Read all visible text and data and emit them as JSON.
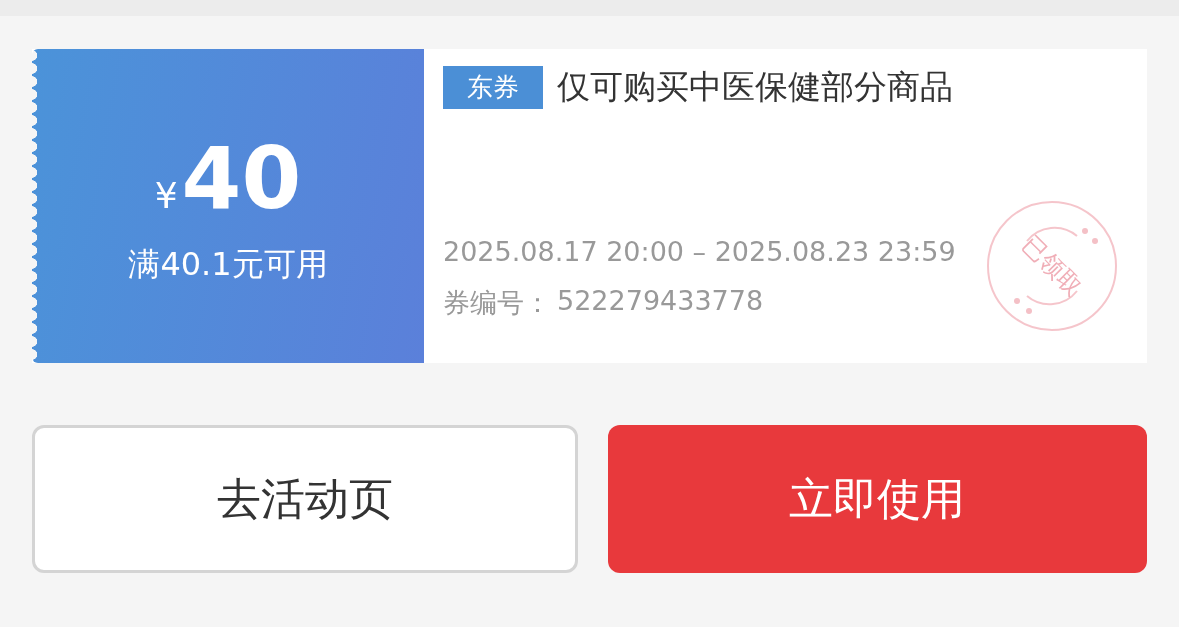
{
  "coupon": {
    "currency": "¥",
    "amount": "40",
    "condition": "满40.1元可用",
    "tag": "东券",
    "title": "仅可购买中医保健部分商品",
    "validity": "2025.08.17 20:00 – 2025.08.23 23:59",
    "code_label": "券编号：",
    "code": "522279433778",
    "stamp": {
      "label": "已领取"
    }
  },
  "buttons": [
    {
      "label": "去活动页",
      "kind": "secondary"
    },
    {
      "label": "立即使用",
      "kind": "primary"
    }
  ]
}
